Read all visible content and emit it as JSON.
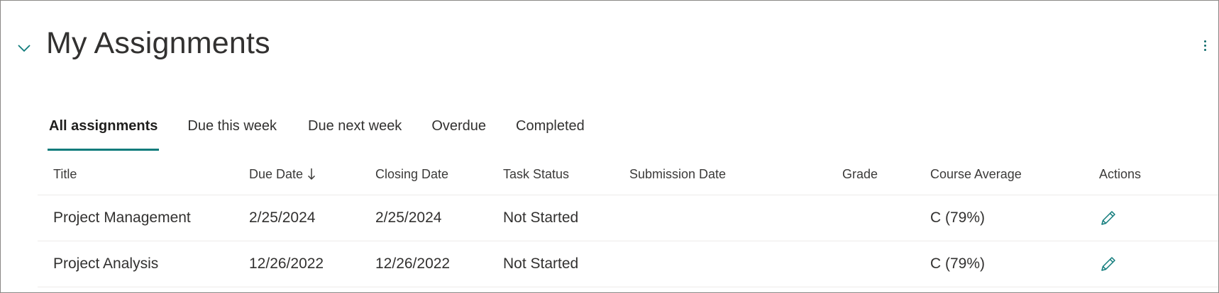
{
  "header": {
    "title": "My Assignments",
    "collapse_icon": "chevron-down-icon",
    "more_icon": "more-vertical-icon"
  },
  "tabs": [
    {
      "label": "All assignments",
      "active": true
    },
    {
      "label": "Due this week",
      "active": false
    },
    {
      "label": "Due next week",
      "active": false
    },
    {
      "label": "Overdue",
      "active": false
    },
    {
      "label": "Completed",
      "active": false
    }
  ],
  "table": {
    "columns": {
      "title": "Title",
      "due_date": "Due Date",
      "closing_date": "Closing Date",
      "task_status": "Task Status",
      "submission_date": "Submission Date",
      "grade": "Grade",
      "course_average": "Course Average",
      "actions": "Actions"
    },
    "sort_icon": "arrow-down-icon",
    "rows": [
      {
        "title": "Project Management",
        "due_date": "2/25/2024",
        "closing_date": "2/25/2024",
        "task_status": "Not Started",
        "submission_date": "",
        "grade": "",
        "course_average": "C (79%)",
        "action_icon": "edit-pencil-icon"
      },
      {
        "title": "Project Analysis",
        "due_date": "12/26/2022",
        "closing_date": "12/26/2022",
        "task_status": "Not Started",
        "submission_date": "",
        "grade": "",
        "course_average": "C (79%)",
        "action_icon": "edit-pencil-icon"
      }
    ]
  },
  "colors": {
    "accent": "#0f7b7b",
    "text": "#323130",
    "border": "#8a8886"
  }
}
